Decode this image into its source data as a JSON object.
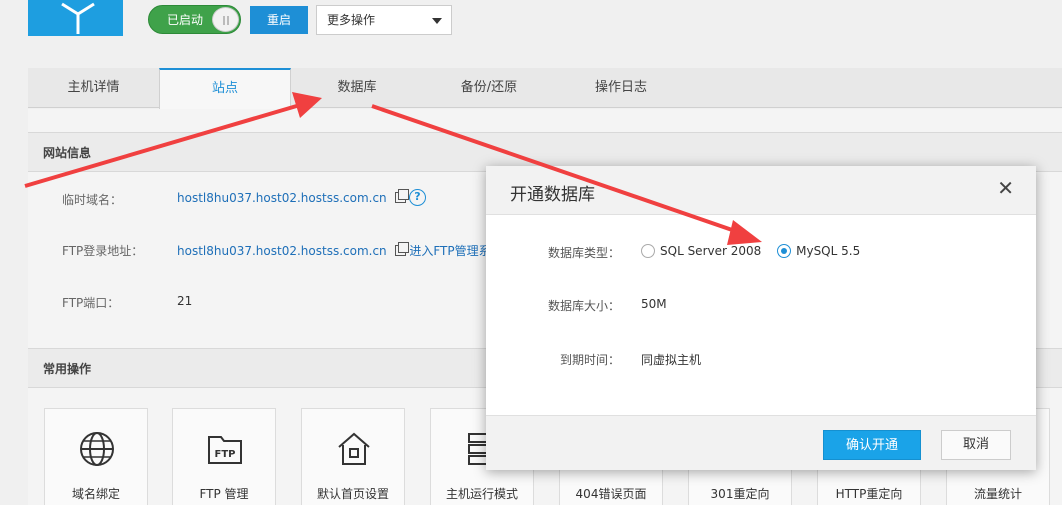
{
  "topbar": {
    "status_toggle": "已启动",
    "restart_button": "重启",
    "more_actions": "更多操作"
  },
  "tabs": [
    {
      "label": "主机详情"
    },
    {
      "label": "站点"
    },
    {
      "label": "数据库"
    },
    {
      "label": "备份/还原"
    },
    {
      "label": "操作日志"
    }
  ],
  "site_info": {
    "title": "网站信息",
    "temp_domain_label": "临时域名：",
    "temp_domain_value": "hostl8hu037.host02.hostss.com.cn",
    "ftp_addr_label": "FTP登录地址：",
    "ftp_addr_value": "hostl8hu037.host02.hostss.com.cn",
    "ftp_manage_link": "进入FTP管理系统",
    "ftp_port_label": "FTP端口：",
    "ftp_port_value": "21"
  },
  "common_ops": {
    "title": "常用操作",
    "cards": [
      {
        "label": "域名绑定",
        "icon": "globe-icon"
      },
      {
        "label": "FTP 管理",
        "icon": "ftp-folder-icon"
      },
      {
        "label": "默认首页设置",
        "icon": "home-icon"
      },
      {
        "label": "主机运行模式",
        "icon": "server-icon"
      },
      {
        "label": "404错误页面",
        "icon": "error-page-icon"
      },
      {
        "label": "301重定向",
        "icon": "redirect-icon"
      },
      {
        "label": "HTTP重定向",
        "icon": "http-redirect-icon"
      },
      {
        "label": "流量统计",
        "icon": "traffic-stats-icon"
      }
    ]
  },
  "modal": {
    "title": "开通数据库",
    "db_type_label": "数据库类型：",
    "db_type_options": [
      {
        "label": "SQL Server 2008",
        "selected": false
      },
      {
        "label": "MySQL 5.5",
        "selected": true
      }
    ],
    "db_size_label": "数据库大小：",
    "db_size_value": "50M",
    "expire_label": "到期时间：",
    "expire_value": "同虚拟主机",
    "confirm_button": "确认开通",
    "cancel_button": "取消"
  },
  "colors": {
    "accent": "#1e8fd6",
    "toggle_on": "#3fa24a",
    "annotation_arrow": "#f04040"
  }
}
